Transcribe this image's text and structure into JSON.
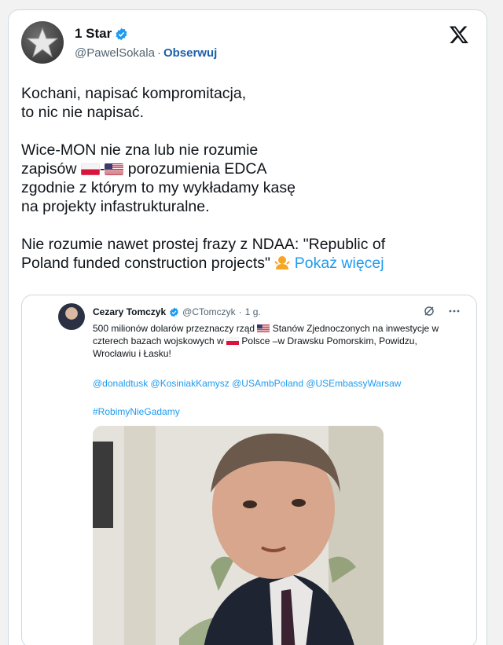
{
  "author": {
    "name": "1 Star",
    "handle": "@PawelSokala",
    "separator": "·",
    "follow_label": "Obserwuj"
  },
  "tweet": {
    "para1_line1": "Kochani, napisać kompromitacja,",
    "para1_line2": "to nic nie napisać.",
    "para2_line1": "Wice-MON nie zna lub nie rozumie",
    "para2_line2_a": "zapisów ",
    "para2_line2_dash": "-",
    "para2_line2_b": " porozumienia EDCA",
    "para2_line3": "zgodnie z którym to my wykładamy kasę",
    "para2_line4": "na projekty infastrukturalne.",
    "para3_line1": "Nie rozumie nawet prostej frazy z NDAA: \"Republic of",
    "para3_line2": "Poland funded construction projects\" ",
    "show_more": "Pokaż więcej"
  },
  "quote": {
    "name": "Cezary Tomczyk",
    "handle": "@CTomczyk",
    "separator": "·",
    "time": "1 g.",
    "text_a": "500 milionów dolarów przeznaczy rząd ",
    "text_b": " Stanów Zjednoczonych na inwestycje w czterech bazach wojskowych w ",
    "text_c": " Polsce –w Drawsku Pomorskim, Powidzu, Wrocławiu i Łasku!",
    "mentions": "@donaldtusk @KosiniakKamysz @USAmbPoland @USEmbassyWarsaw",
    "hashtag": "#RobimyNieGadamy"
  },
  "icons": {
    "verified": "verified-badge-icon",
    "x_logo": "x-logo-icon",
    "grok": "grok-icon",
    "more": "more-options-icon"
  },
  "colors": {
    "link": "#1d9bf0",
    "follow": "#1d5fa8",
    "text": "#0f1419",
    "muted": "#536471"
  }
}
